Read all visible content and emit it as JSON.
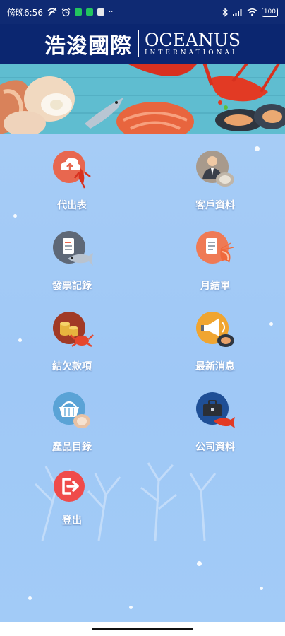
{
  "status_bar": {
    "time": "傍晚6:56",
    "battery": "100"
  },
  "header": {
    "brand_cn": "浩浚國際",
    "brand_en": "OCEANUS",
    "brand_en_sub": "INTERNATIONAL"
  },
  "menu": {
    "items": [
      {
        "label": "代出表",
        "icon": "cloud-upload-lobster-icon"
      },
      {
        "label": "客戶資料",
        "icon": "customer-oyster-icon"
      },
      {
        "label": "發票記錄",
        "icon": "invoice-fish-icon"
      },
      {
        "label": "月結單",
        "icon": "monthly-statement-shrimp-icon"
      },
      {
        "label": "結欠款項",
        "icon": "coins-crab-icon"
      },
      {
        "label": "最新消息",
        "icon": "megaphone-mussel-icon"
      },
      {
        "label": "產品目錄",
        "icon": "basket-shellfish-icon"
      },
      {
        "label": "公司資料",
        "icon": "briefcase-fish-icon"
      },
      {
        "label": "登出",
        "icon": "logout-icon"
      }
    ]
  },
  "colors": {
    "header_bg": "#0b2670",
    "main_bg": "#a6ccf6",
    "logout_red": "#ef4b4b"
  }
}
